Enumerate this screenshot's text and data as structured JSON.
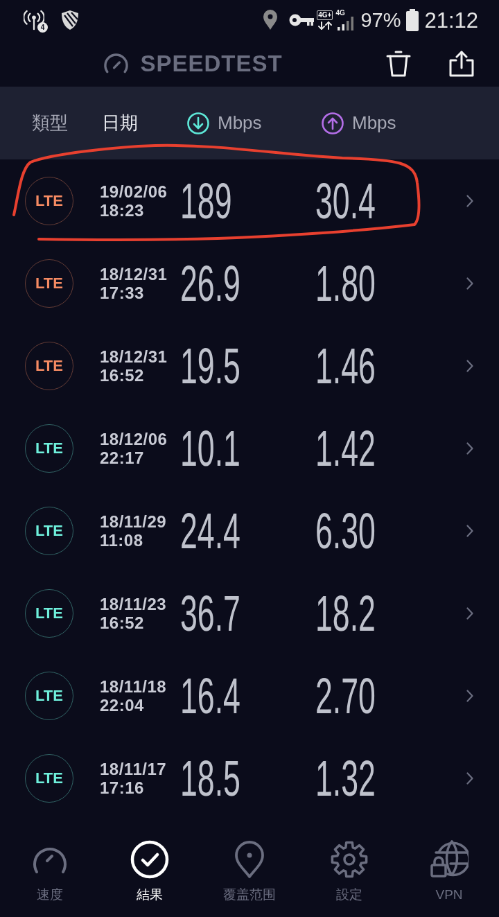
{
  "status_bar": {
    "hotspot_badge": "4",
    "network_type": "4G+",
    "signal_type": "4G",
    "battery": "97%",
    "time": "21:12"
  },
  "app_bar": {
    "title": "SPEEDTEST"
  },
  "columns": [
    {
      "kind": "text",
      "label": "類型",
      "selected": false
    },
    {
      "kind": "text",
      "label": "日期",
      "selected": true
    },
    {
      "kind": "download",
      "label": "Mbps",
      "selected": false
    },
    {
      "kind": "upload",
      "label": "Mbps",
      "selected": false
    }
  ],
  "rows": [
    {
      "type": "LTE",
      "color": "#f68b63",
      "date": "19/02/06",
      "time": "18:23",
      "download": "189",
      "upload": "30.4",
      "circled": true
    },
    {
      "type": "LTE",
      "color": "#f68b63",
      "date": "18/12/31",
      "time": "17:33",
      "download": "26.9",
      "upload": "1.80",
      "circled": false
    },
    {
      "type": "LTE",
      "color": "#f68b63",
      "date": "18/12/31",
      "time": "16:52",
      "download": "19.5",
      "upload": "1.46",
      "circled": false
    },
    {
      "type": "LTE",
      "color": "#6ff0dc",
      "date": "18/12/06",
      "time": "22:17",
      "download": "10.1",
      "upload": "1.42",
      "circled": false
    },
    {
      "type": "LTE",
      "color": "#6ff0dc",
      "date": "18/11/29",
      "time": "11:08",
      "download": "24.4",
      "upload": "6.30",
      "circled": false
    },
    {
      "type": "LTE",
      "color": "#6ff0dc",
      "date": "18/11/23",
      "time": "16:52",
      "download": "36.7",
      "upload": "18.2",
      "circled": false
    },
    {
      "type": "LTE",
      "color": "#6ff0dc",
      "date": "18/11/18",
      "time": "22:04",
      "download": "16.4",
      "upload": "2.70",
      "circled": false
    },
    {
      "type": "LTE",
      "color": "#6ff0dc",
      "date": "18/11/17",
      "time": "17:16",
      "download": "18.5",
      "upload": "1.32",
      "circled": false
    }
  ],
  "bottom_nav": [
    {
      "kind": "speed",
      "label": "速度",
      "selected": false
    },
    {
      "kind": "results",
      "label": "結果",
      "selected": true
    },
    {
      "kind": "coverage",
      "label": "覆盖范围",
      "selected": false
    },
    {
      "kind": "settings",
      "label": "設定",
      "selected": false
    },
    {
      "kind": "vpn",
      "label": "VPN",
      "selected": false
    }
  ]
}
